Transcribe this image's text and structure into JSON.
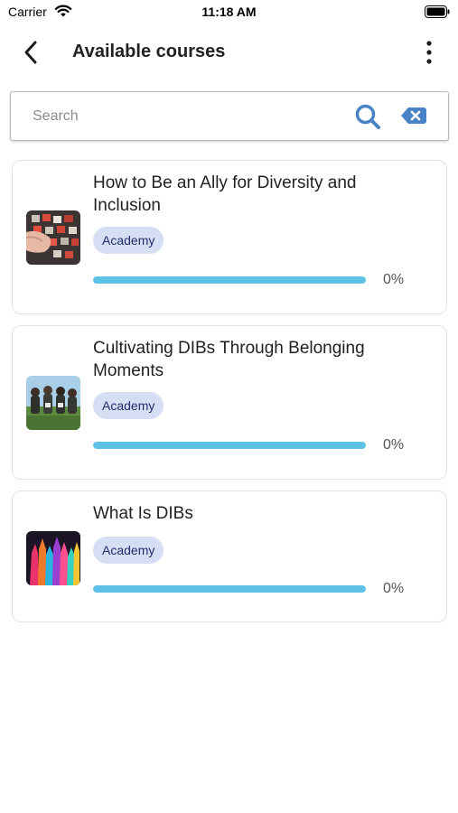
{
  "status_bar": {
    "carrier": "Carrier",
    "time": "11:18 AM"
  },
  "nav": {
    "title": "Available courses"
  },
  "search": {
    "placeholder": "Search",
    "value": ""
  },
  "colors": {
    "accent": "#5ec1e8",
    "badge_bg": "#d6def3",
    "icon_blue": "#4a82c8"
  },
  "courses": [
    {
      "title": "How to Be an Ally for Diversity and Inclusion",
      "badge": "Academy",
      "progress": 0,
      "progress_label": "0%"
    },
    {
      "title": "Cultivating DIBs Through Belonging Moments",
      "badge": "Academy",
      "progress": 0,
      "progress_label": "0%"
    },
    {
      "title": "What Is DIBs",
      "badge": "Academy",
      "progress": 0,
      "progress_label": "0%"
    }
  ]
}
